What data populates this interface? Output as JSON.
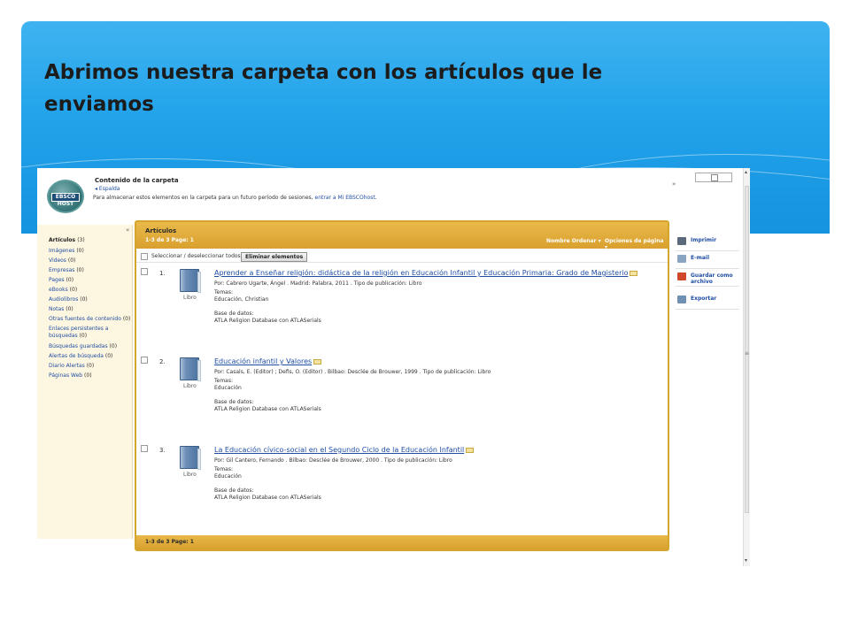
{
  "slide": {
    "title": "Abrimos nuestra carpeta con los artículos que le enviamos",
    "colors": {
      "banner": "#22a3ea",
      "panel_border": "#d4a62b",
      "link": "#1f4ea3"
    }
  },
  "header": {
    "logo_text": "EBSCO HOST",
    "folder_title": "Contenido de la carpeta",
    "back_link": "Espalda",
    "store_text": "Para almacenar estos elementos en la carpeta para un futuro período de sesiones,",
    "store_link": "entrar a Mi EBSCOhost",
    "store_end": "."
  },
  "sidebar": {
    "collapse_icon": "«",
    "items": [
      {
        "label": "Artículos",
        "count": "(3)",
        "active": true
      },
      {
        "label": "Imágenes",
        "count": "(0)"
      },
      {
        "label": "Videos",
        "count": "(0)"
      },
      {
        "label": "Empresas",
        "count": "(0)"
      },
      {
        "label": "Pages",
        "count": "(0)"
      },
      {
        "label": "eBooks",
        "count": "(0)"
      },
      {
        "label": "Audiolibros",
        "count": "(0)"
      },
      {
        "label": "Notas",
        "count": "(0)"
      },
      {
        "label": "Otras fuentes de contenido",
        "count": "(0)"
      },
      {
        "label": "Enlaces persistentes a",
        "label2": "búsquedas",
        "count": "(0)"
      },
      {
        "label": "Búsquedas guardadas",
        "count": "(0)"
      },
      {
        "label": "Alertas de búsqueda",
        "count": "(0)"
      },
      {
        "label": "Diario Alertas",
        "count": "(0)"
      },
      {
        "label": "Páginas Web",
        "count": "(0)"
      }
    ]
  },
  "main": {
    "title": "Artículos",
    "pager": "1-3 de 3   Page: 1",
    "sort_label": "Nombre Ordenar ▾",
    "options_label": "Opciones de página ▾",
    "select_all": "Seleccionar / deseleccionar todos",
    "delete_button": "Eliminar elementos",
    "footer_pager": "1-3 de 3   Page: 1",
    "results": [
      {
        "num": "1.",
        "type": "Libro",
        "title": "Aprender a Enseñar religión: didáctica de la religión en Educación Infantil y Educación Primaria: Grado de Magisterio",
        "byline": "Por: Cabrero Ugarte, Ángel . Madrid: Palabra, 2011 . Tipo de publicación: Libro",
        "topics_label": "Temas:",
        "topics": "Educación, Christian",
        "db_label": "Base de datos:",
        "db": "ATLA Religion Database con ATLASerials"
      },
      {
        "num": "2.",
        "type": "Libro",
        "title": "Educación infantil y Valores",
        "byline": "Por: Casals, E. (Editor) ;  Defis, O. (Editor) . Bilbao: Desclée de Brouwer, 1999 . Tipo de publicación: Libro",
        "topics_label": "Temas:",
        "topics": "Educación",
        "db_label": "Base de datos:",
        "db": "ATLA Religion Database con ATLASerials"
      },
      {
        "num": "3.",
        "type": "Libro",
        "title": "La Educación cívico-social en el Segundo Ciclo de la Educación Infantil",
        "byline": "Por: Gil Cantero, Fernando . Bilbao: Desclée de Brouwer, 2000 . Tipo de publicación: Libro",
        "topics_label": "Temas:",
        "topics": "Educación",
        "db_label": "Base de datos:",
        "db": "ATLA Religion Database con ATLASerials"
      }
    ]
  },
  "tools": {
    "collapse_icon": "»",
    "items": [
      {
        "label": "Imprimir",
        "icon": "printer-icon",
        "color": "#5a6a7a"
      },
      {
        "label": "E-mail",
        "icon": "email-icon",
        "color": "#8aa4c4"
      },
      {
        "label": "Guardar como",
        "label2": "archivo",
        "icon": "save-icon",
        "color": "#d0492a"
      },
      {
        "label": "Exportar",
        "icon": "export-icon",
        "color": "#6f8fb3"
      }
    ]
  }
}
